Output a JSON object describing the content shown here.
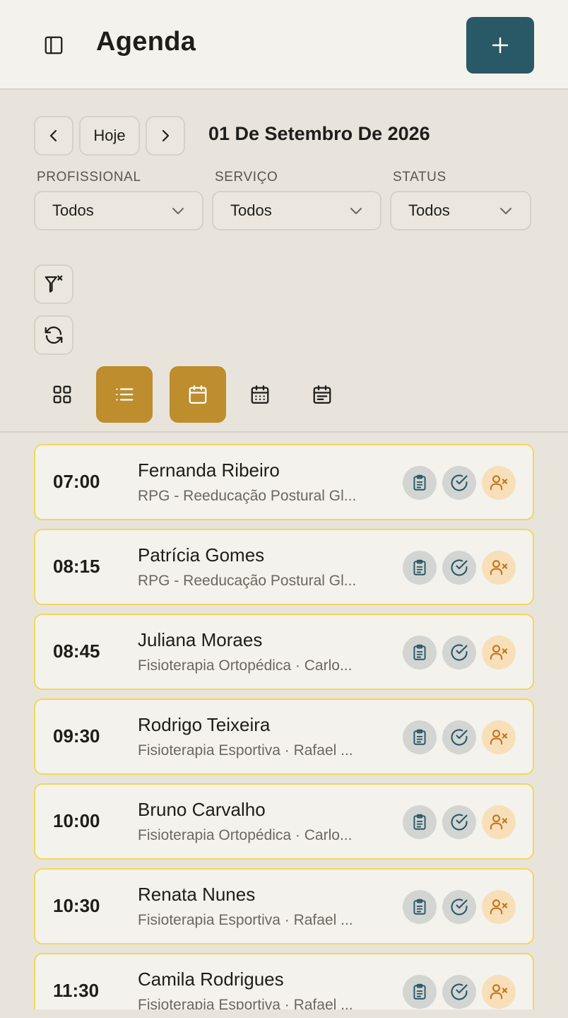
{
  "header": {
    "title": "Agenda"
  },
  "nav": {
    "today_label": "Hoje",
    "date": "01 De Setembro De 2026"
  },
  "filters": [
    {
      "label": "PROFISSIONAL",
      "value": "Todos"
    },
    {
      "label": "SERVIÇO",
      "value": "Todos"
    },
    {
      "label": "STATUS",
      "value": "Todos"
    }
  ],
  "colors": {
    "primary": "#295866",
    "accent": "#bd8d2e",
    "card_border": "#f0d760",
    "cancel": "#c7731d"
  },
  "appointments": [
    {
      "time": "07:00",
      "name": "Fernanda Ribeiro",
      "desc": "RPG - Reeducação Postural Gl..."
    },
    {
      "time": "08:15",
      "name": "Patrícia Gomes",
      "desc": "RPG - Reeducação Postural Gl..."
    },
    {
      "time": "08:45",
      "name": "Juliana Moraes",
      "desc": "Fisioterapia Ortopédica · Carlo..."
    },
    {
      "time": "09:30",
      "name": "Rodrigo Teixeira",
      "desc": "Fisioterapia Esportiva · Rafael ..."
    },
    {
      "time": "10:00",
      "name": "Bruno Carvalho",
      "desc": "Fisioterapia Ortopédica · Carlo..."
    },
    {
      "time": "10:30",
      "name": "Renata Nunes",
      "desc": "Fisioterapia Esportiva · Rafael ..."
    },
    {
      "time": "11:30",
      "name": "Camila Rodrigues",
      "desc": "Fisioterapia Esportiva · Rafael ..."
    }
  ]
}
